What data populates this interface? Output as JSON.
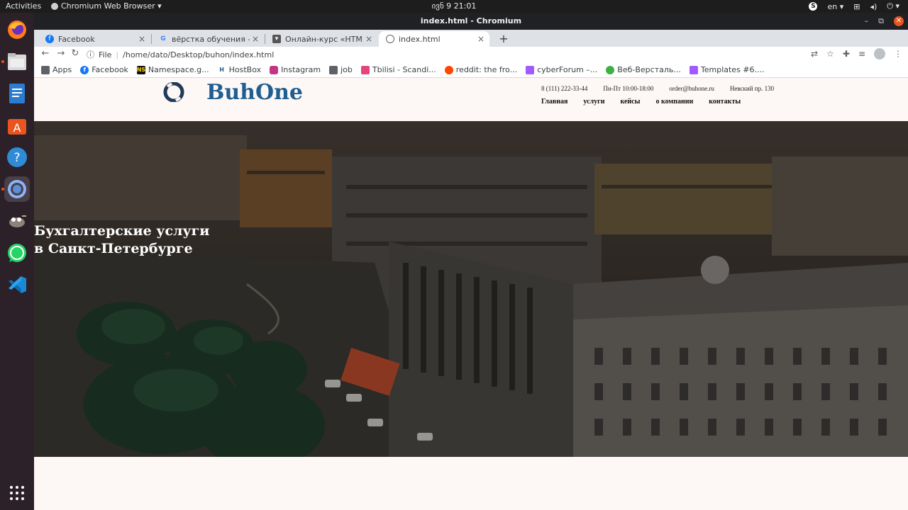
{
  "system": {
    "activities": "Activities",
    "app_menu": "Chromium Web Browser ▾",
    "clock": "ივნ 9  21:01",
    "lang": "en ▾"
  },
  "window": {
    "title": "index.html - Chromium"
  },
  "tabs": [
    {
      "title": "Facebook"
    },
    {
      "title": "вёрстка обучения - Goog"
    },
    {
      "title": "Онлайн-курс «HTML и CS"
    },
    {
      "title": "index.html"
    }
  ],
  "address": {
    "scheme": "File",
    "url": "/home/dato/Desktop/buhon/index.html"
  },
  "bookmarks": [
    {
      "label": "Apps"
    },
    {
      "label": "Facebook"
    },
    {
      "label": "Namespace.g..."
    },
    {
      "label": "HostBox"
    },
    {
      "label": "Instagram"
    },
    {
      "label": "job"
    },
    {
      "label": "Tbilisi - Scandi..."
    },
    {
      "label": "reddit: the fro..."
    },
    {
      "label": "cyberForum –..."
    },
    {
      "label": "Веб-Версталь..."
    },
    {
      "label": "Templates #6...."
    }
  ],
  "site": {
    "brand": "BuhOne",
    "contacts": {
      "phone": "8 (111) 222-33-44",
      "hours": "Пн-Пт 10:00-18:00",
      "email": "order@buhone.ru",
      "address": "Невский пр. 130"
    },
    "nav": [
      "Главная",
      "услуги",
      "кейсы",
      "о компании",
      "контакты"
    ],
    "hero_title": "Бухгалтерские услуги в Санкт-Петербурге"
  }
}
